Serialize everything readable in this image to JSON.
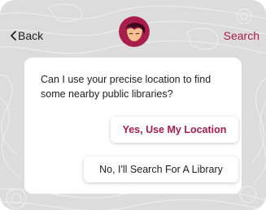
{
  "header": {
    "back_label": "Back",
    "search_label": "Search"
  },
  "dialog": {
    "prompt": "Can I use your precise location to find some nearby public libraries?",
    "primary_label": "Yes, Use My Location",
    "secondary_label": "No, I'll Search For A Library"
  },
  "colors": {
    "accent": "#a81d4a",
    "background": "#dcdcdc",
    "card": "#ffffff",
    "text": "#1f1f1f"
  },
  "icons": {
    "back": "chevron-left-icon",
    "logo": "app-logo-icon"
  }
}
